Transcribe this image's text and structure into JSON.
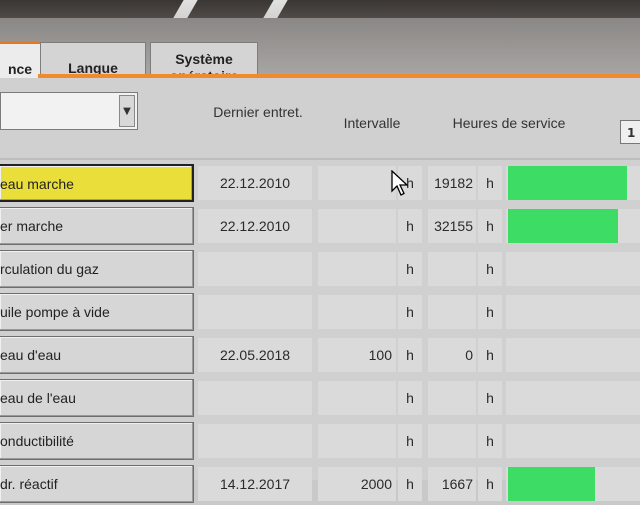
{
  "tabs": [
    {
      "label": "nce",
      "active": true
    },
    {
      "label": "Langue",
      "active": false
    },
    {
      "label": "Système opératoire",
      "active": false
    }
  ],
  "dropdown": {
    "value": ""
  },
  "headers": {
    "last_service": "Dernier entret.",
    "interval": "Intervalle",
    "service_hours": "Heures de service"
  },
  "page_indicator": "1",
  "colors": {
    "accent": "#f08a2c",
    "selected": "#e9de3a",
    "status_ok": "#3ddc64"
  },
  "rows": [
    {
      "name": "eau marche",
      "date": "22.12.2010",
      "interval": "",
      "interval_unit": "h",
      "hours": "19182",
      "hours_unit": "h",
      "status_fill": 0.93,
      "selected": true
    },
    {
      "name": "er marche",
      "date": "22.12.2010",
      "interval": "",
      "interval_unit": "h",
      "hours": "32155",
      "hours_unit": "h",
      "status_fill": 0.86,
      "selected": false
    },
    {
      "name": "rculation du gaz",
      "date": "",
      "interval": "",
      "interval_unit": "h",
      "hours": "",
      "hours_unit": "h",
      "status_fill": 0,
      "selected": false
    },
    {
      "name": "uile pompe à vide",
      "date": "",
      "interval": "",
      "interval_unit": "h",
      "hours": "",
      "hours_unit": "h",
      "status_fill": 0,
      "selected": false
    },
    {
      "name": "eau d'eau",
      "date": "22.05.2018",
      "interval": "100",
      "interval_unit": "h",
      "hours": "0",
      "hours_unit": "h",
      "status_fill": 0,
      "selected": false
    },
    {
      "name": "eau de l'eau",
      "date": "",
      "interval": "",
      "interval_unit": "h",
      "hours": "",
      "hours_unit": "h",
      "status_fill": 0,
      "selected": false
    },
    {
      "name": "onductibilité",
      "date": "",
      "interval": "",
      "interval_unit": "h",
      "hours": "",
      "hours_unit": "h",
      "status_fill": 0,
      "selected": false
    },
    {
      "name": "dr. réactif",
      "date": "14.12.2017",
      "interval": "2000",
      "interval_unit": "h",
      "hours": "1667",
      "hours_unit": "h",
      "status_fill": 0.68,
      "selected": false
    }
  ]
}
